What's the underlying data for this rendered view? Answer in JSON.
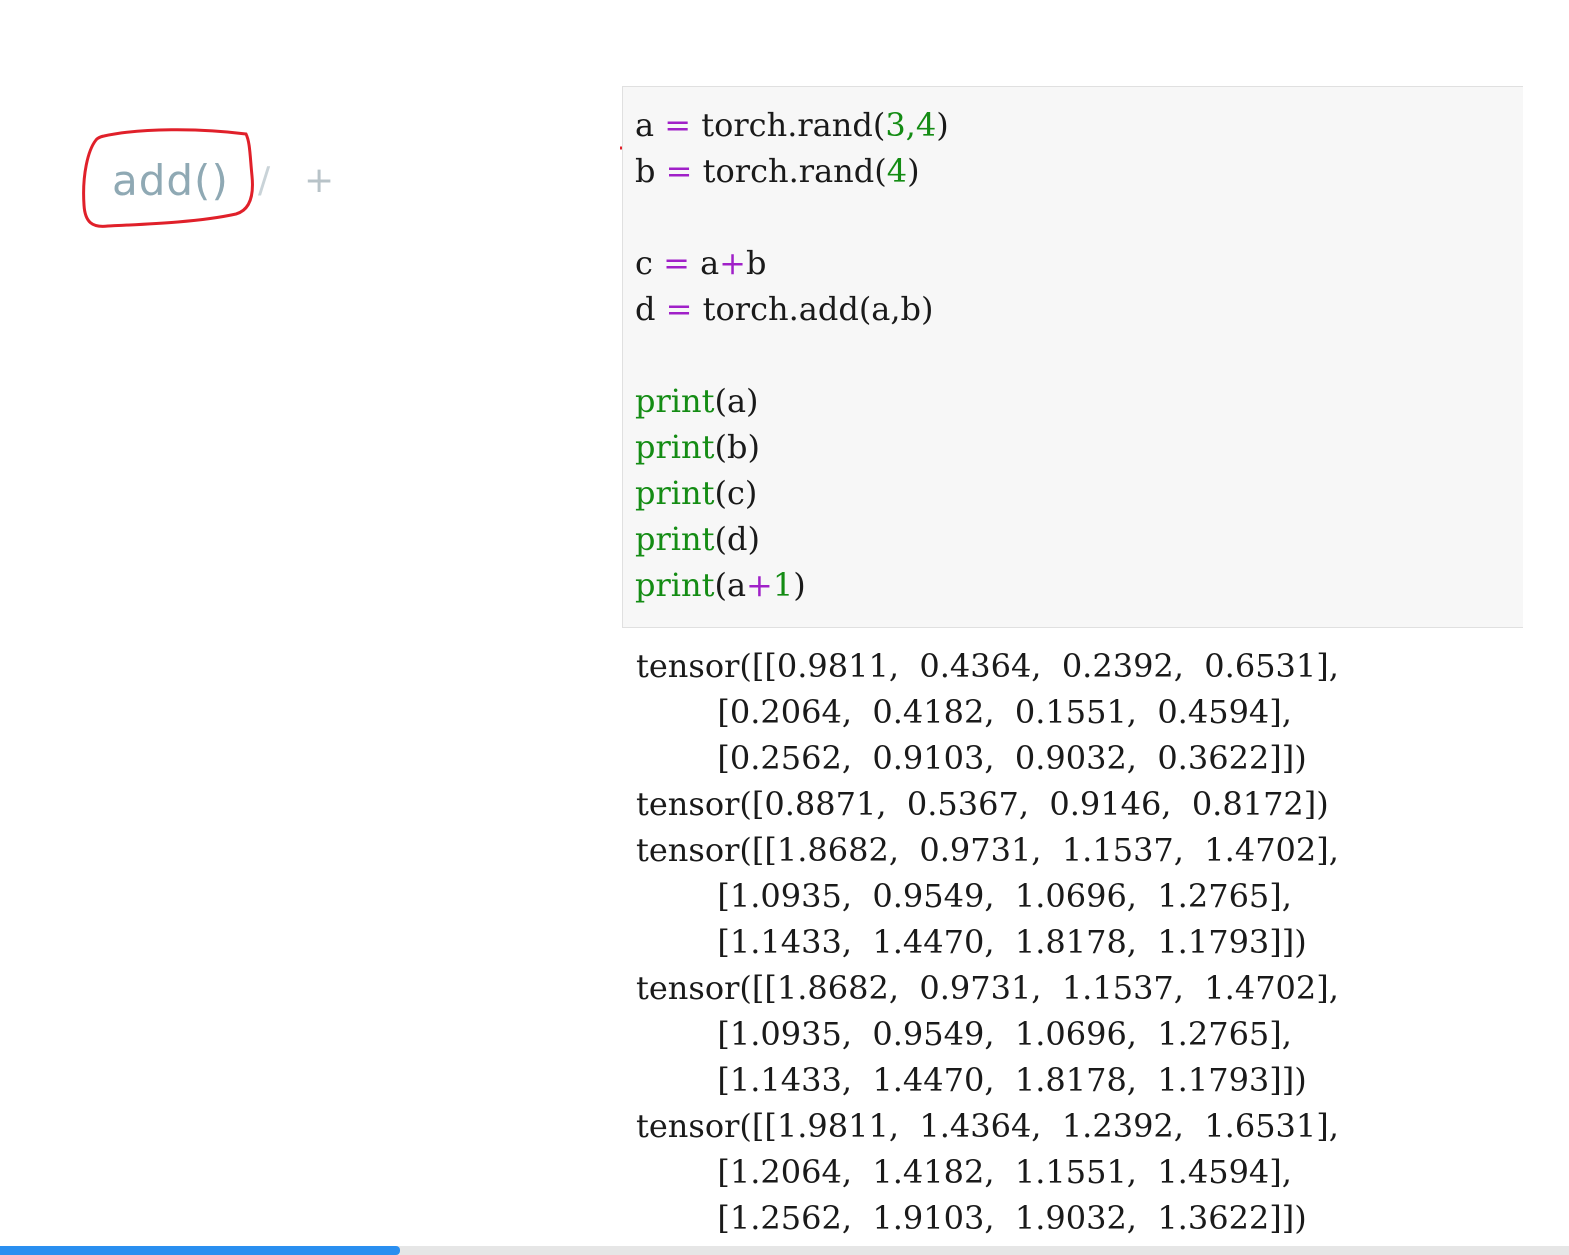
{
  "annotation": {
    "func_label": "add()",
    "separator": "/",
    "operator": "+"
  },
  "code": {
    "lines": [
      {
        "var": "a",
        "eq": "=",
        "expr_pre": "torch.rand(",
        "args": "3,4",
        "expr_post": ")"
      },
      {
        "var": "b",
        "eq": "=",
        "expr_pre": "torch.rand(",
        "args": "4",
        "expr_post": ")"
      },
      {
        "var": "c",
        "eq": "=",
        "lhs": "a",
        "plus": "+",
        "rhs": "b"
      },
      {
        "var": "d",
        "eq": "=",
        "expr": "torch.add(a,b)"
      },
      {
        "fn": "print",
        "arg": "(a)"
      },
      {
        "fn": "print",
        "arg": "(b)"
      },
      {
        "fn": "print",
        "arg": "(c)"
      },
      {
        "fn": "print",
        "arg": "(d)"
      },
      {
        "fn": "print",
        "arg_pre": "(a",
        "plus": "+",
        "arg_num": "1",
        "arg_post": ")"
      }
    ]
  },
  "output": {
    "lines": [
      "tensor([[0.9811,  0.4364,  0.2392,  0.6531],",
      "        [0.2064,  0.4182,  0.1551,  0.4594],",
      "        [0.2562,  0.9103,  0.9032,  0.3622]])",
      "tensor([0.8871,  0.5367,  0.9146,  0.8172])",
      "tensor([[1.8682,  0.9731,  1.1537,  1.4702],",
      "        [1.0935,  0.9549,  1.0696,  1.2765],",
      "        [1.1433,  1.4470,  1.8178,  1.1793]])",
      "tensor([[1.8682,  0.9731,  1.1537,  1.4702],",
      "        [1.0935,  0.9549,  1.0696,  1.2765],",
      "        [1.1433,  1.4470,  1.8178,  1.1793]])",
      "tensor([[1.9811,  1.4364,  1.2392,  1.6531],",
      "        [1.2064,  1.4182,  1.1551,  1.4594],",
      "        [1.2562,  1.9103,  1.9032,  1.3622]])"
    ]
  },
  "progress": {
    "fraction": 0.255
  },
  "colors": {
    "annotation_red": "#e0202a",
    "keyword_green": "#148c14",
    "operator_purple": "#a020c8",
    "progress_blue": "#2a8ff0"
  }
}
